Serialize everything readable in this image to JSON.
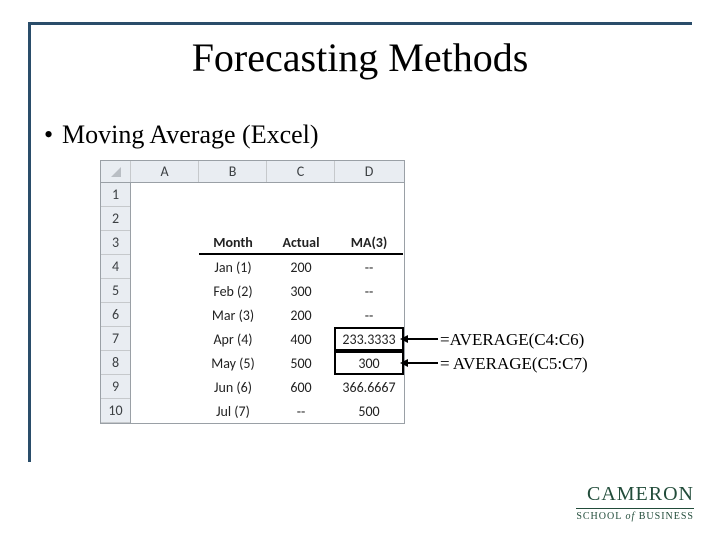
{
  "slide": {
    "title": "Forecasting Methods",
    "bullet": "Moving Average (Excel)"
  },
  "excel": {
    "columns": [
      "A",
      "B",
      "C",
      "D"
    ],
    "row_labels": [
      "1",
      "2",
      "3",
      "4",
      "5",
      "6",
      "7",
      "8",
      "9",
      "10"
    ],
    "header_row": {
      "B": "Month",
      "C": "Actual",
      "D": "MA(3)"
    },
    "data_rows": [
      {
        "B": "Jan (1)",
        "C": "200",
        "D": "--"
      },
      {
        "B": "Feb (2)",
        "C": "300",
        "D": "--"
      },
      {
        "B": "Mar (3)",
        "C": "200",
        "D": "--"
      },
      {
        "B": "Apr (4)",
        "C": "400",
        "D": "233.3333"
      },
      {
        "B": "May (5)",
        "C": "500",
        "D": "300"
      },
      {
        "B": "Jun (6)",
        "C": "600",
        "D": "366.6667"
      },
      {
        "B": "Jul (7)",
        "C": "--",
        "D": "500"
      }
    ]
  },
  "annotations": {
    "formula1": "=AVERAGE(C4:C6)",
    "formula2": "= AVERAGE(C5:C7)"
  },
  "logo": {
    "line1": "CAMERON",
    "line2_a": "SCHOOL",
    "line2_b": "of",
    "line2_c": "BUSINESS"
  }
}
